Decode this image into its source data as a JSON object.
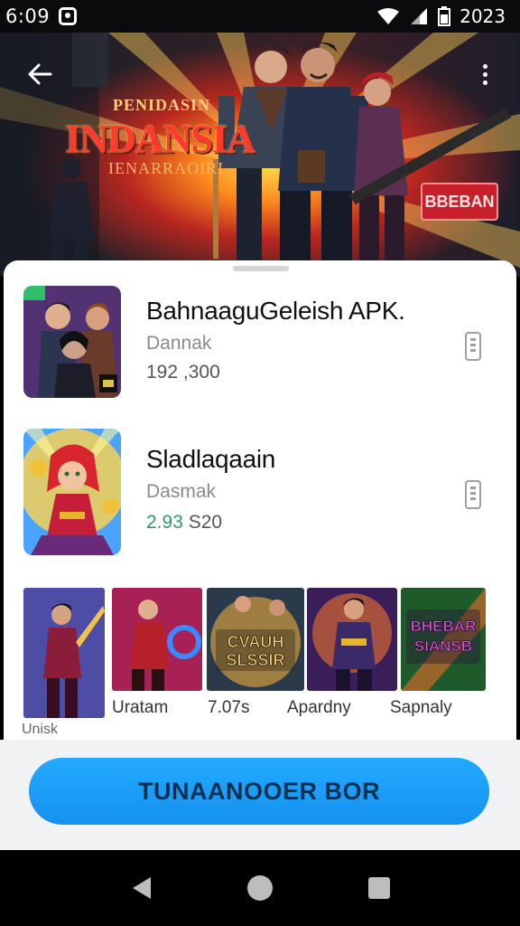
{
  "status_bar": {
    "time": "6:09",
    "clock": "2023",
    "icons": [
      "notification-icon",
      "wifi-icon",
      "signal-icon",
      "battery-icon"
    ]
  },
  "hero": {
    "subtitle": "PENIDASIN",
    "title": "INDANSIA",
    "tagline": "IENARRAOIRI",
    "badge": "BBEBAN"
  },
  "apps": [
    {
      "name": "BahnaaguGeleish APK.",
      "developer": "Dannak",
      "stats_a": "192",
      "stats_b": ",300",
      "thumb_icon": "game-cover-squad"
    },
    {
      "name": "Sladlaqaain",
      "developer": "Dasmak",
      "stats_a": "2.93",
      "stats_b": "S20",
      "thumb_icon": "game-cover-heroine"
    }
  ],
  "screenshots": {
    "captions": [
      "Uratam",
      "7.07s",
      "Apardny",
      "Sapnaly"
    ],
    "under_caption": "Unisk",
    "overlay_texts": [
      {
        "line1": "CVAUH",
        "line2": "SLSSIR"
      },
      {
        "line1": "BHEBAR",
        "line2": "SIANSB"
      }
    ]
  },
  "cta": {
    "label": "TUNAANOOER BOR"
  },
  "colors": {
    "cta_blue": "#1a9bf5",
    "hero_red": "#ff3b2a",
    "stat_green": "#2f9a67"
  }
}
